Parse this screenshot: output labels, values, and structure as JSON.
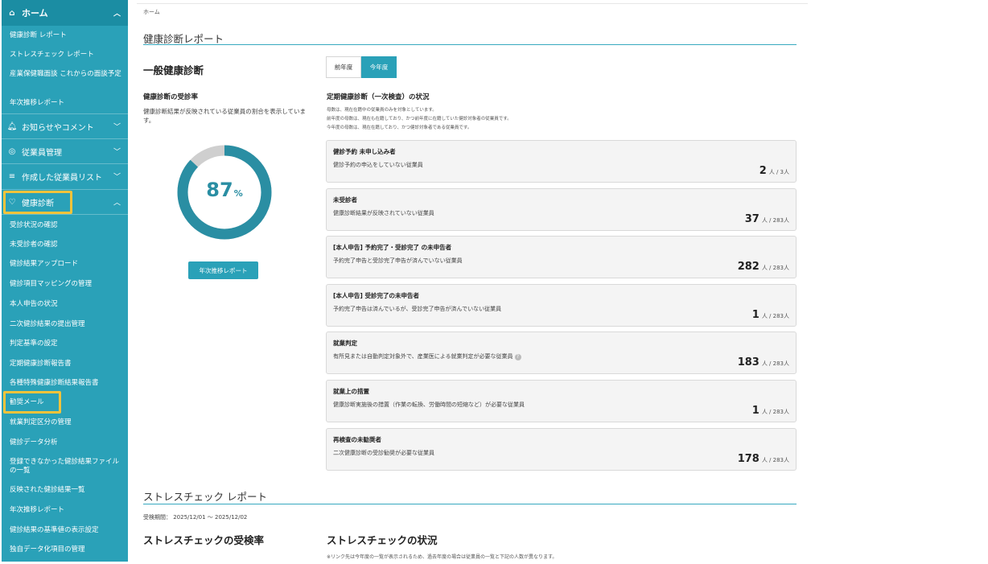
{
  "sidebar": {
    "home": "ホーム",
    "home_items": [
      "健康診断 レポート",
      "ストレスチェック レポート",
      "産業保健職面談 これからの面談予定",
      "年次推移レポート"
    ],
    "sections": [
      "お知らせやコメント",
      "従業員管理",
      "作成した従業員リスト",
      "健康診断"
    ],
    "health_items": [
      "受診状況の確認",
      "未受診者の確認",
      "健診結果アップロード",
      "健診項目マッピングの管理",
      "本人申告の状況",
      "二次健診結果の提出管理",
      "判定基準の設定",
      "定期健康診断報告書",
      "各種特殊健康診断結果報告書",
      "勧奨メール",
      "就業判定区分の管理",
      "健診データ分析",
      "登録できなかった健診結果ファイルの一覧",
      "反映された健診結果一覧",
      "年次推移レポート",
      "健診結果の基準値の表示設定",
      "独自データ化項目の管理"
    ]
  },
  "breadcrumb": "ホーム",
  "health": {
    "section_title": "健康診断レポート",
    "general_title": "一般健康診断",
    "tabs": [
      "前年度",
      "今年度"
    ],
    "rate_title": "健康診断の受診率",
    "rate_desc": "健康診断結果が反映されている従業員の割合を表示しています。",
    "rate_value": "87",
    "rate_unit": "%",
    "rate_fraction": 0.87,
    "trend_button": "年次推移レポート",
    "status_title": "定期健康診断（一次検査）の状況",
    "notes": [
      "母数は、現在在籍中の従業員のみを対象としています。",
      "前年度の母数は、現在も在籍しており、かつ前年度に在籍していた健診対象者の従業員です。",
      "今年度の母数は、現在在籍しており、かつ健診対象者である従業員です。"
    ],
    "cards": [
      {
        "title": "健診予約 未申し込み者",
        "desc": "健診予約の申込をしていない従業員",
        "value": "2",
        "unit": "人 / 3人"
      },
      {
        "title": "未受診者",
        "desc": "健康診断結果が反映されていない従業員",
        "value": "37",
        "unit": "人 / 283人"
      },
      {
        "title": "[本人申告] 予約完了・受診完了 の未申告者",
        "desc": "予約完了申告と受診完了申告が済んでいない従業員",
        "value": "282",
        "unit": "人 / 283人"
      },
      {
        "title": "[本人申告] 受診完了の未申告者",
        "desc": "予約完了申告は済んでいるが、受診完了申告が済んでいない従業員",
        "value": "1",
        "unit": "人 / 283人"
      },
      {
        "title": "就業判定",
        "desc": "有所見または自動判定対象外で、産業医による就業判定が必要な従業員",
        "value": "183",
        "unit": "人 / 283人"
      },
      {
        "title": "就業上の措置",
        "desc": "健康診断実施後の措置（作業の転換、労働時間の短縮など）が必要な従業員",
        "value": "1",
        "unit": "人 / 283人"
      },
      {
        "title": "再検査の未勧奨者",
        "desc": "二次健康診断の受診勧奨が必要な従業員",
        "value": "178",
        "unit": "人 / 283人"
      }
    ]
  },
  "stress": {
    "section_title": "ストレスチェック レポート",
    "period": "受検期間： 2025/12/01 〜 2025/12/02",
    "rate_title": "ストレスチェックの受検率",
    "status_title": "ストレスチェックの状況",
    "note": "※リンク先は今年度の一覧が表示されるため、過去年度の場合は従業員の一覧と下記の人数が異なります。"
  },
  "colors": {
    "sidebar": "#2aa1b8",
    "sidebar_active": "#1b8da3",
    "accent": "#2a8ea3",
    "highlight": "#f4c33a",
    "donut_rest": "#cfcfcf"
  },
  "icons": {
    "home": "home-icon",
    "bell": "bell-icon",
    "users": "users-icon",
    "list": "list-icon",
    "health": "health-icon"
  }
}
